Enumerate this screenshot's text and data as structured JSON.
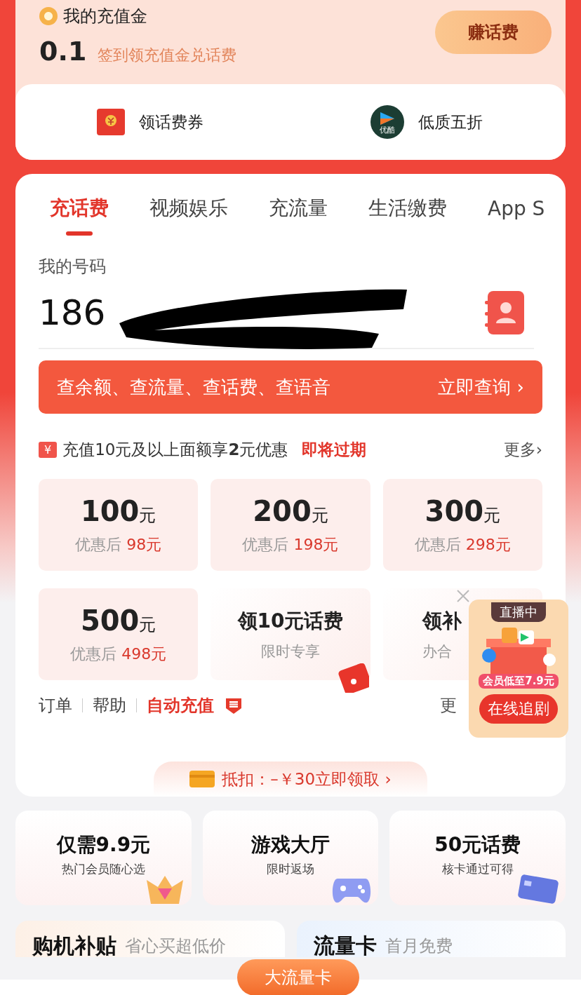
{
  "wallet": {
    "title": "我的充值金",
    "amount": "0.1",
    "hint": "签到领充值金兑话费",
    "button": "赚话费"
  },
  "shortcuts": [
    {
      "label": "领话费券",
      "kind": "coupon"
    },
    {
      "label": "低质五折",
      "kind": "video",
      "icon_text": "优酷"
    }
  ],
  "tabs": [
    {
      "label": "充话费",
      "selected": true
    },
    {
      "label": "视频娱乐",
      "selected": false
    },
    {
      "label": "充流量",
      "selected": false
    },
    {
      "label": "生活缴费",
      "selected": false
    },
    {
      "label": "App S",
      "selected": false
    }
  ],
  "phone": {
    "label": "我的号码",
    "value": "186"
  },
  "query_banner": {
    "text": "查余额、查流量、查话费、查语音",
    "action": "立即查询 ›"
  },
  "promo": {
    "icon_text": "¥",
    "text": "充值10元及以上面额享**2**元优惠",
    "badge": "即将过期",
    "more": "更多›"
  },
  "products": [
    {
      "kind": "amount",
      "value": "100",
      "unit": "元",
      "caption": "优惠后",
      "price": "98元"
    },
    {
      "kind": "amount",
      "value": "200",
      "unit": "元",
      "caption": "优惠后",
      "price": "198元"
    },
    {
      "kind": "amount",
      "value": "300",
      "unit": "元",
      "caption": "优惠后",
      "price": "298元"
    },
    {
      "kind": "amount",
      "value": "500",
      "unit": "元",
      "caption": "优惠后",
      "price": "498元"
    },
    {
      "kind": "offer",
      "title": "领10元话费",
      "subtitle": "限时专享"
    },
    {
      "kind": "offer",
      "title": "领补",
      "subtitle": "办合"
    }
  ],
  "links": [
    {
      "label": "订单",
      "kind": "plain"
    },
    {
      "label": "帮助",
      "kind": "plain"
    },
    {
      "label": "自动充值",
      "kind": "highlight"
    }
  ],
  "links_more": "更",
  "deduction": "抵扣：–￥30立即领取 ›",
  "features": [
    {
      "title": "仅需9.9元",
      "subtitle": "热门会员随心选",
      "kind": "gem"
    },
    {
      "title": "游戏大厅",
      "subtitle": "限时返场",
      "kind": "gamepad"
    },
    {
      "title": "50元话费",
      "subtitle": "核卡通过可得",
      "kind": "card"
    }
  ],
  "banners": [
    {
      "title": "购机补贴",
      "subtitle": "省心买超低价"
    },
    {
      "title": "流量卡",
      "subtitle": "首月免费"
    }
  ],
  "floating_tag": "大流量卡",
  "live_ad": {
    "badge": "直播中",
    "caption": "会员低至7.9元",
    "button": "在线追剧"
  }
}
